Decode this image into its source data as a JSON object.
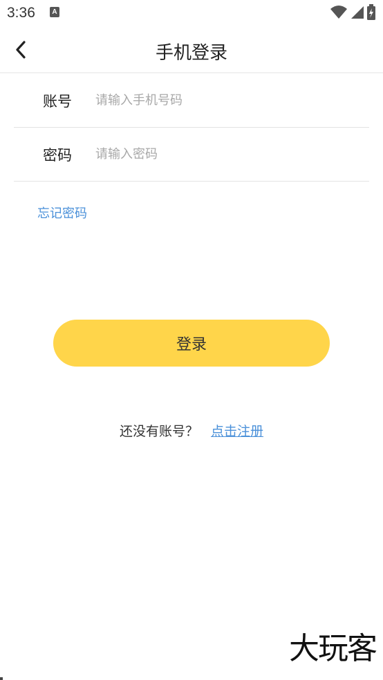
{
  "status_bar": {
    "time": "3:36",
    "notification_icon": "A",
    "icons": [
      "wifi-icon",
      "signal-icon",
      "battery-icon"
    ]
  },
  "header": {
    "title": "手机登录",
    "back_icon": "chevron-left-icon"
  },
  "form": {
    "account": {
      "label": "账号",
      "value": "",
      "placeholder": "请输入手机号码"
    },
    "password": {
      "label": "密码",
      "value": "",
      "placeholder": "请输入密码"
    }
  },
  "forgot_password": "忘记密码",
  "login_button": "登录",
  "register": {
    "prompt": "还没有账号？",
    "link": "点击注册"
  },
  "watermark": "大玩客",
  "colors": {
    "accent_button": "#ffd54a",
    "link": "#4a90d9"
  }
}
